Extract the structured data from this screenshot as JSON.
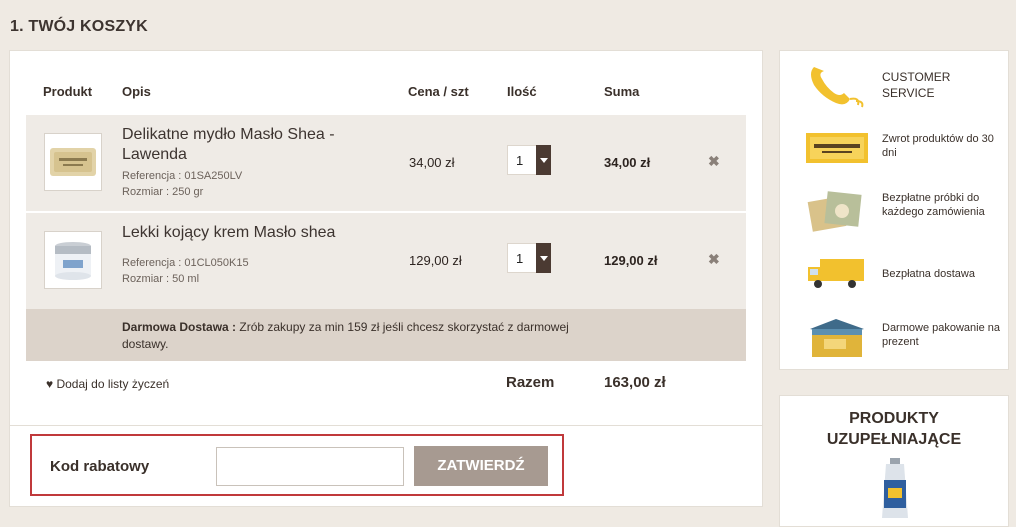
{
  "step_title": "1. TWÓJ KOSZYK",
  "table": {
    "headers": [
      "Produkt",
      "Opis",
      "Cena / szt",
      "Ilość",
      "Suma"
    ]
  },
  "items": [
    {
      "name": "Delikatne mydło Masło Shea - Lawenda",
      "reference": "Referencja : 01SA250LV",
      "size": "Rozmiar : 250 gr",
      "price": "34,00 zł",
      "quantity": "1",
      "total": "34,00 zł",
      "remove_icon": "close-icon"
    },
    {
      "name": "Lekki kojący krem Masło shea",
      "reference": "Referencja : 01CL050K15",
      "size": "Rozmiar : 50 ml",
      "price": "129,00 zł",
      "quantity": "1",
      "total": "129,00 zł",
      "remove_icon": "close-icon"
    }
  ],
  "shipping": {
    "label": "Darmowa Dostawa :",
    "text": " Zrób zakupy za min 159 zł jeśli chcesz skorzystać z darmowej dostawy."
  },
  "wishlist": {
    "icon": "heart-icon",
    "label": "Dodaj do listy życzeń"
  },
  "summary": {
    "label": "Razem",
    "value": "163,00 zł"
  },
  "discount": {
    "label": "Kod rabatowy",
    "input_value": "",
    "button": "ZATWIERDŹ"
  },
  "sidebar": {
    "items": [
      {
        "icon": "phone-icon",
        "text": "CUSTOMER SERVICE"
      },
      {
        "icon": "loccitane-logo-icon",
        "text": "Zwrot produktów do 30 dni"
      },
      {
        "icon": "sample-packets-icon",
        "text": "Bezpłatne próbki do każdego zamówienia"
      },
      {
        "icon": "delivery-truck-icon",
        "text": "Bezpłatna dostawa"
      },
      {
        "icon": "gift-box-icon",
        "text": "Darmowe pakowanie na prezent"
      }
    ]
  },
  "complementary": {
    "title": "PRODUKTY UZUPEŁNIAJĄCE"
  },
  "colors": {
    "background": "#efeae3",
    "row_bg": "#efebe6",
    "shipping_bg": "#dcd3ca",
    "button_bg": "#a79a91",
    "highlight_border": "#c0393b",
    "brand_yellow": "#f2c12e"
  }
}
